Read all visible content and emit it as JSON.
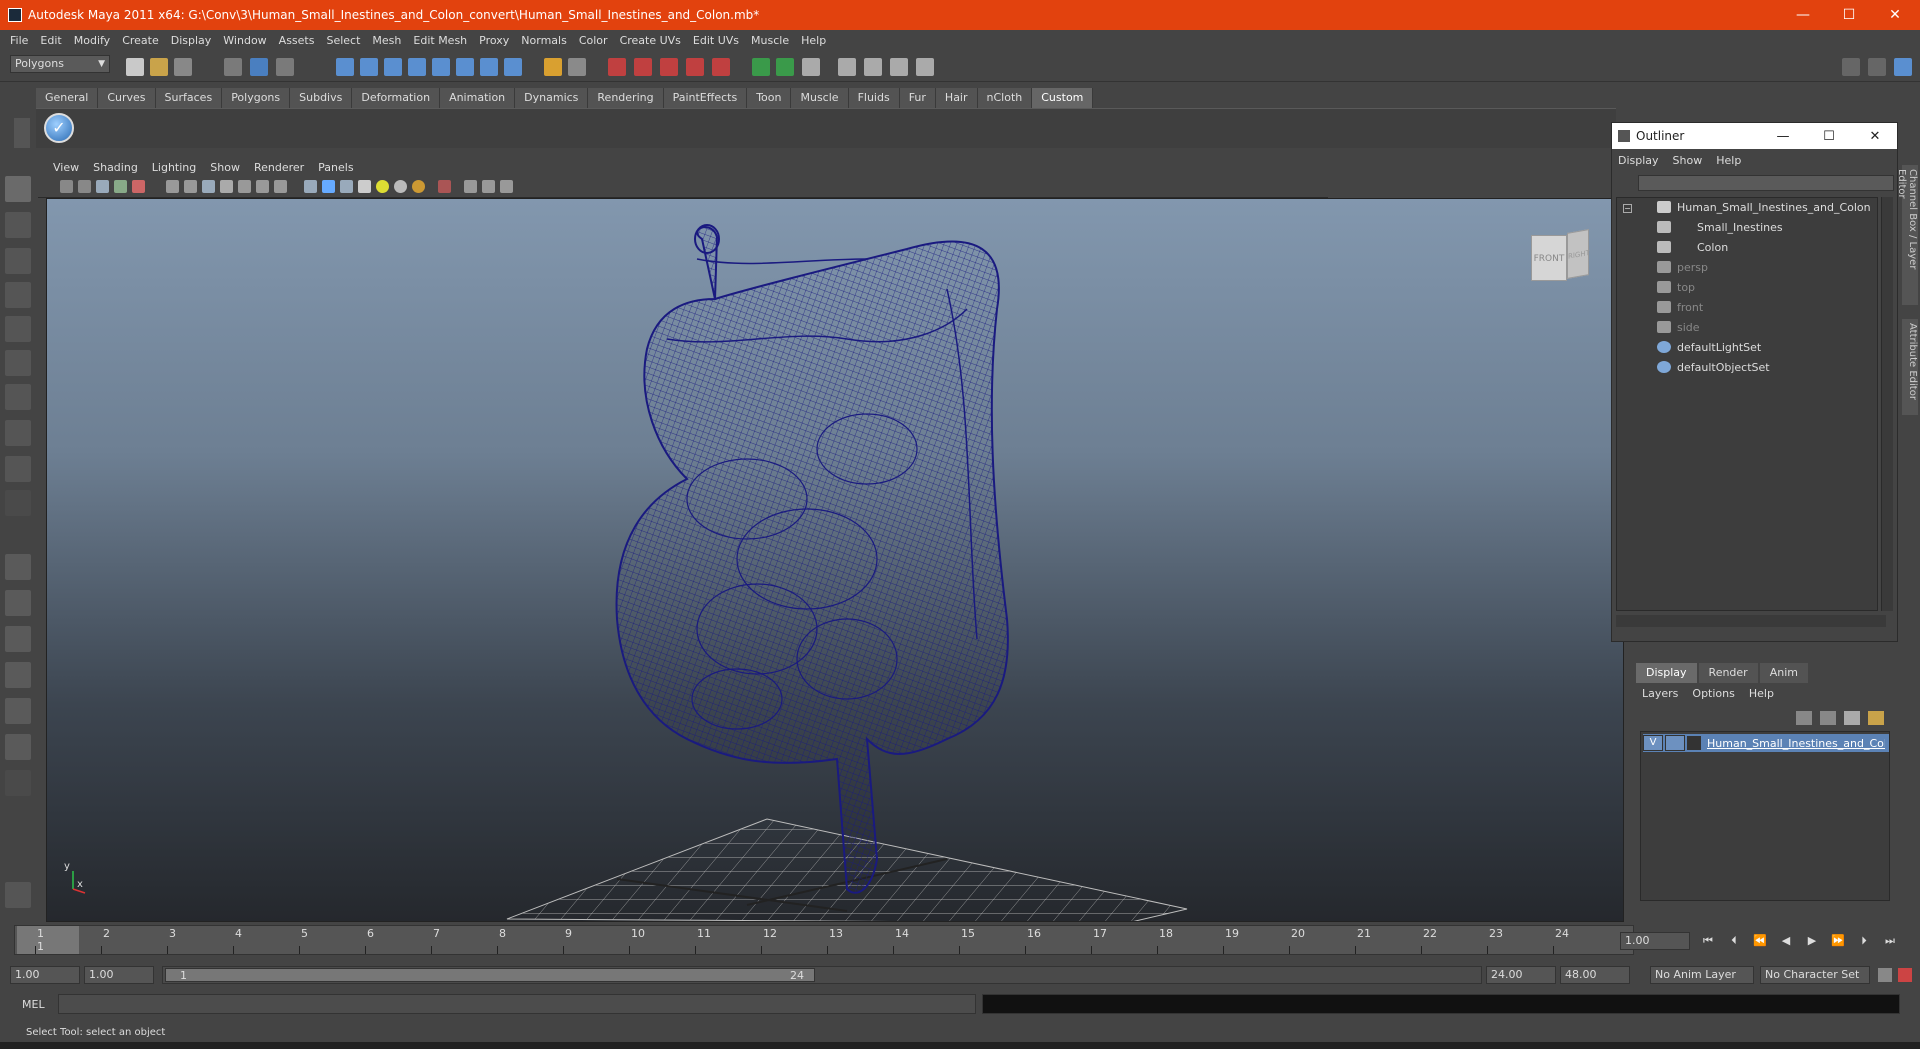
{
  "window": {
    "title": "Autodesk Maya 2011 x64: G:\\Conv\\3\\Human_Small_Inestines_and_Colon_convert\\Human_Small_Inestines_and_Colon.mb*",
    "minimize": "—",
    "maximize": "☐",
    "close": "✕"
  },
  "menubar": [
    "File",
    "Edit",
    "Modify",
    "Create",
    "Display",
    "Window",
    "Assets",
    "Select",
    "Mesh",
    "Edit Mesh",
    "Proxy",
    "Normals",
    "Color",
    "Create UVs",
    "Edit UVs",
    "Muscle",
    "Help"
  ],
  "statusline": {
    "mode": "Polygons"
  },
  "shelf": {
    "tabs": [
      "General",
      "Curves",
      "Surfaces",
      "Polygons",
      "Subdivs",
      "Deformation",
      "Animation",
      "Dynamics",
      "Rendering",
      "PaintEffects",
      "Toon",
      "Muscle",
      "Fluids",
      "Fur",
      "Hair",
      "nCloth",
      "Custom"
    ],
    "active_tab": "Custom",
    "button_glyph": "✓"
  },
  "viewport": {
    "menu": [
      "View",
      "Shading",
      "Lighting",
      "Show",
      "Renderer",
      "Panels"
    ],
    "viewcube": {
      "front": "FRONT",
      "right": "RIGHT"
    },
    "axis": {
      "x": "x",
      "y": "y"
    },
    "wire_color": "#1a1a80"
  },
  "outliner": {
    "title": "Outliner",
    "menu": [
      "Display",
      "Show",
      "Help"
    ],
    "items": [
      {
        "label": "Human_Small_Inestines_and_Colon",
        "dim": false
      },
      {
        "label": "Small_Inestines",
        "dim": false
      },
      {
        "label": "Colon",
        "dim": false
      },
      {
        "label": "persp",
        "dim": true
      },
      {
        "label": "top",
        "dim": true
      },
      {
        "label": "front",
        "dim": true
      },
      {
        "label": "side",
        "dim": true
      },
      {
        "label": "defaultLightSet",
        "dim": false
      },
      {
        "label": "defaultObjectSet",
        "dim": false
      }
    ]
  },
  "sidetabs": [
    "Channel Box / Layer Editor",
    "Attribute Editor"
  ],
  "layer_editor": {
    "tabs": [
      "Display",
      "Render",
      "Anim"
    ],
    "active_tab": "Display",
    "menu": [
      "Layers",
      "Options",
      "Help"
    ],
    "layer": {
      "visible": "V",
      "name": "Human_Small_Inestines_and_Colon_la"
    }
  },
  "timeline": {
    "ticks": [
      "1",
      "2",
      "3",
      "4",
      "5",
      "6",
      "7",
      "8",
      "9",
      "10",
      "11",
      "12",
      "13",
      "14",
      "15",
      "16",
      "17",
      "18",
      "19",
      "20",
      "21",
      "22",
      "23",
      "24"
    ],
    "current_label": "1",
    "current_frame": "1.00"
  },
  "range": {
    "start_time": "1.00",
    "playback_start": "1.00",
    "slider_start": "1",
    "slider_end": "24",
    "playback_end": "24.00",
    "end_time": "48.00",
    "anim_layer": "No Anim Layer",
    "character_set": "No Character Set"
  },
  "cmdline": {
    "label": "MEL"
  },
  "helpline": "Select Tool: select an object"
}
